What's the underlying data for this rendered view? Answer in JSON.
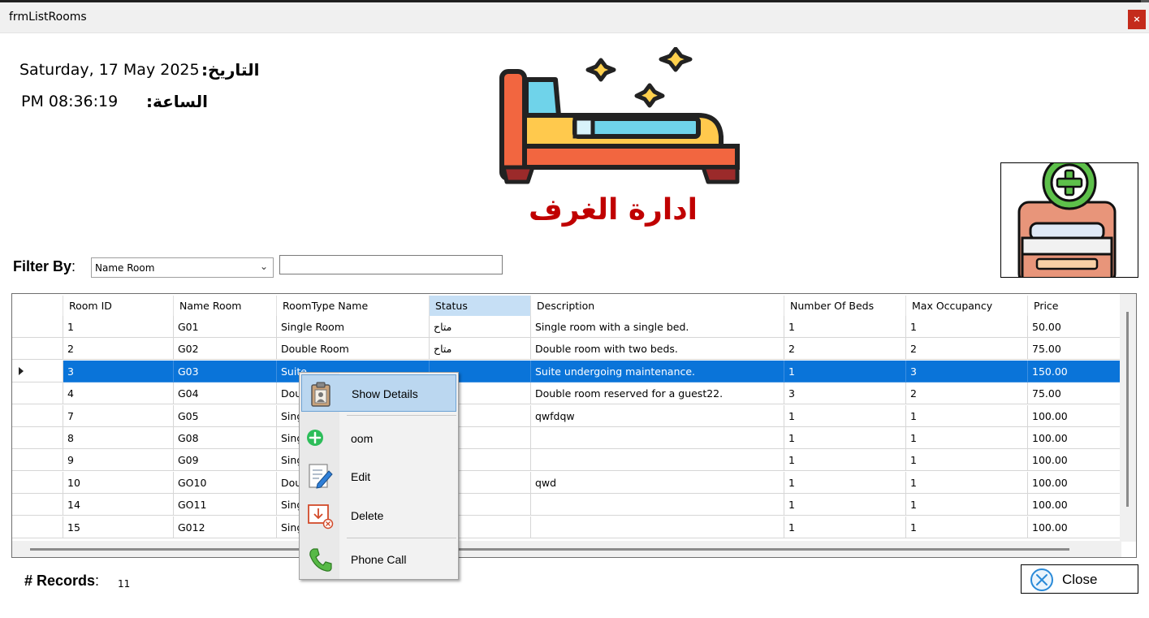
{
  "window": {
    "title": "frmListRooms",
    "close_glyph": "×"
  },
  "header": {
    "date_label": "التاريخ:",
    "date_value": "Saturday, 17 May 2025",
    "time_label": "الساعة:",
    "time_value": "PM 08:36:19",
    "page_title": "ادارة الغرف",
    "illustration_icon": "bed-with-stars-icon",
    "add_room_icon": "add-room-bed-icon"
  },
  "filter": {
    "label": "Filter By",
    "colon": ":",
    "selected": "Name Room",
    "text_value": ""
  },
  "table": {
    "columns": [
      "Room ID",
      "Name Room",
      "RoomType Name",
      "Status",
      "Description",
      "Number Of Beds",
      "Max Occupancy",
      "Price"
    ],
    "active_column": "Status",
    "selected_row": 2,
    "rows": [
      [
        "1",
        "G01",
        "Single Room",
        "متاح",
        "Single room with a single bed.",
        "1",
        "1",
        "50.00"
      ],
      [
        "2",
        "G02",
        "Double Room",
        "متاح",
        "Double room with two beds.",
        "2",
        "2",
        "75.00"
      ],
      [
        "3",
        "G03",
        "Suite",
        "",
        "Suite undergoing maintenance.",
        "1",
        "3",
        "150.00"
      ],
      [
        "4",
        "G04",
        "Dou",
        "",
        "Double room reserved for a guest22.",
        "3",
        "2",
        "75.00"
      ],
      [
        "7",
        "G05",
        "Sing",
        "",
        "qwfdqw",
        "1",
        "1",
        "100.00"
      ],
      [
        "8",
        "G08",
        "Sing",
        "",
        "",
        "1",
        "1",
        "100.00"
      ],
      [
        "9",
        "G09",
        "Sing",
        "",
        "",
        "1",
        "1",
        "100.00"
      ],
      [
        "10",
        "GO10",
        "Dou",
        "",
        "qwd",
        "1",
        "1",
        "100.00"
      ],
      [
        "14",
        "GO11",
        "Sing",
        "",
        "",
        "1",
        "1",
        "100.00"
      ],
      [
        "15",
        "G012",
        "Sing",
        "",
        "",
        "1",
        "1",
        "100.00"
      ]
    ]
  },
  "context_menu": {
    "items": [
      {
        "label": "Show Details",
        "icon": "clipboard-person-icon"
      },
      {
        "label": "oom",
        "icon": "plus-circle-icon"
      },
      {
        "label": "Edit",
        "icon": "edit-document-icon"
      },
      {
        "label": "Delete",
        "icon": "delete-document-icon"
      },
      {
        "label": "Phone Call",
        "icon": "phone-icon"
      }
    ]
  },
  "footer": {
    "records_label": "# Records",
    "colon": ":",
    "records_value": "11",
    "close_label": "Close",
    "close_icon": "close-circle-icon"
  },
  "colors": {
    "title_red": "#c00000",
    "selection_blue": "#0a74d9",
    "menu_highlight": "#bbd7f0",
    "header_active": "#c6dff5"
  }
}
